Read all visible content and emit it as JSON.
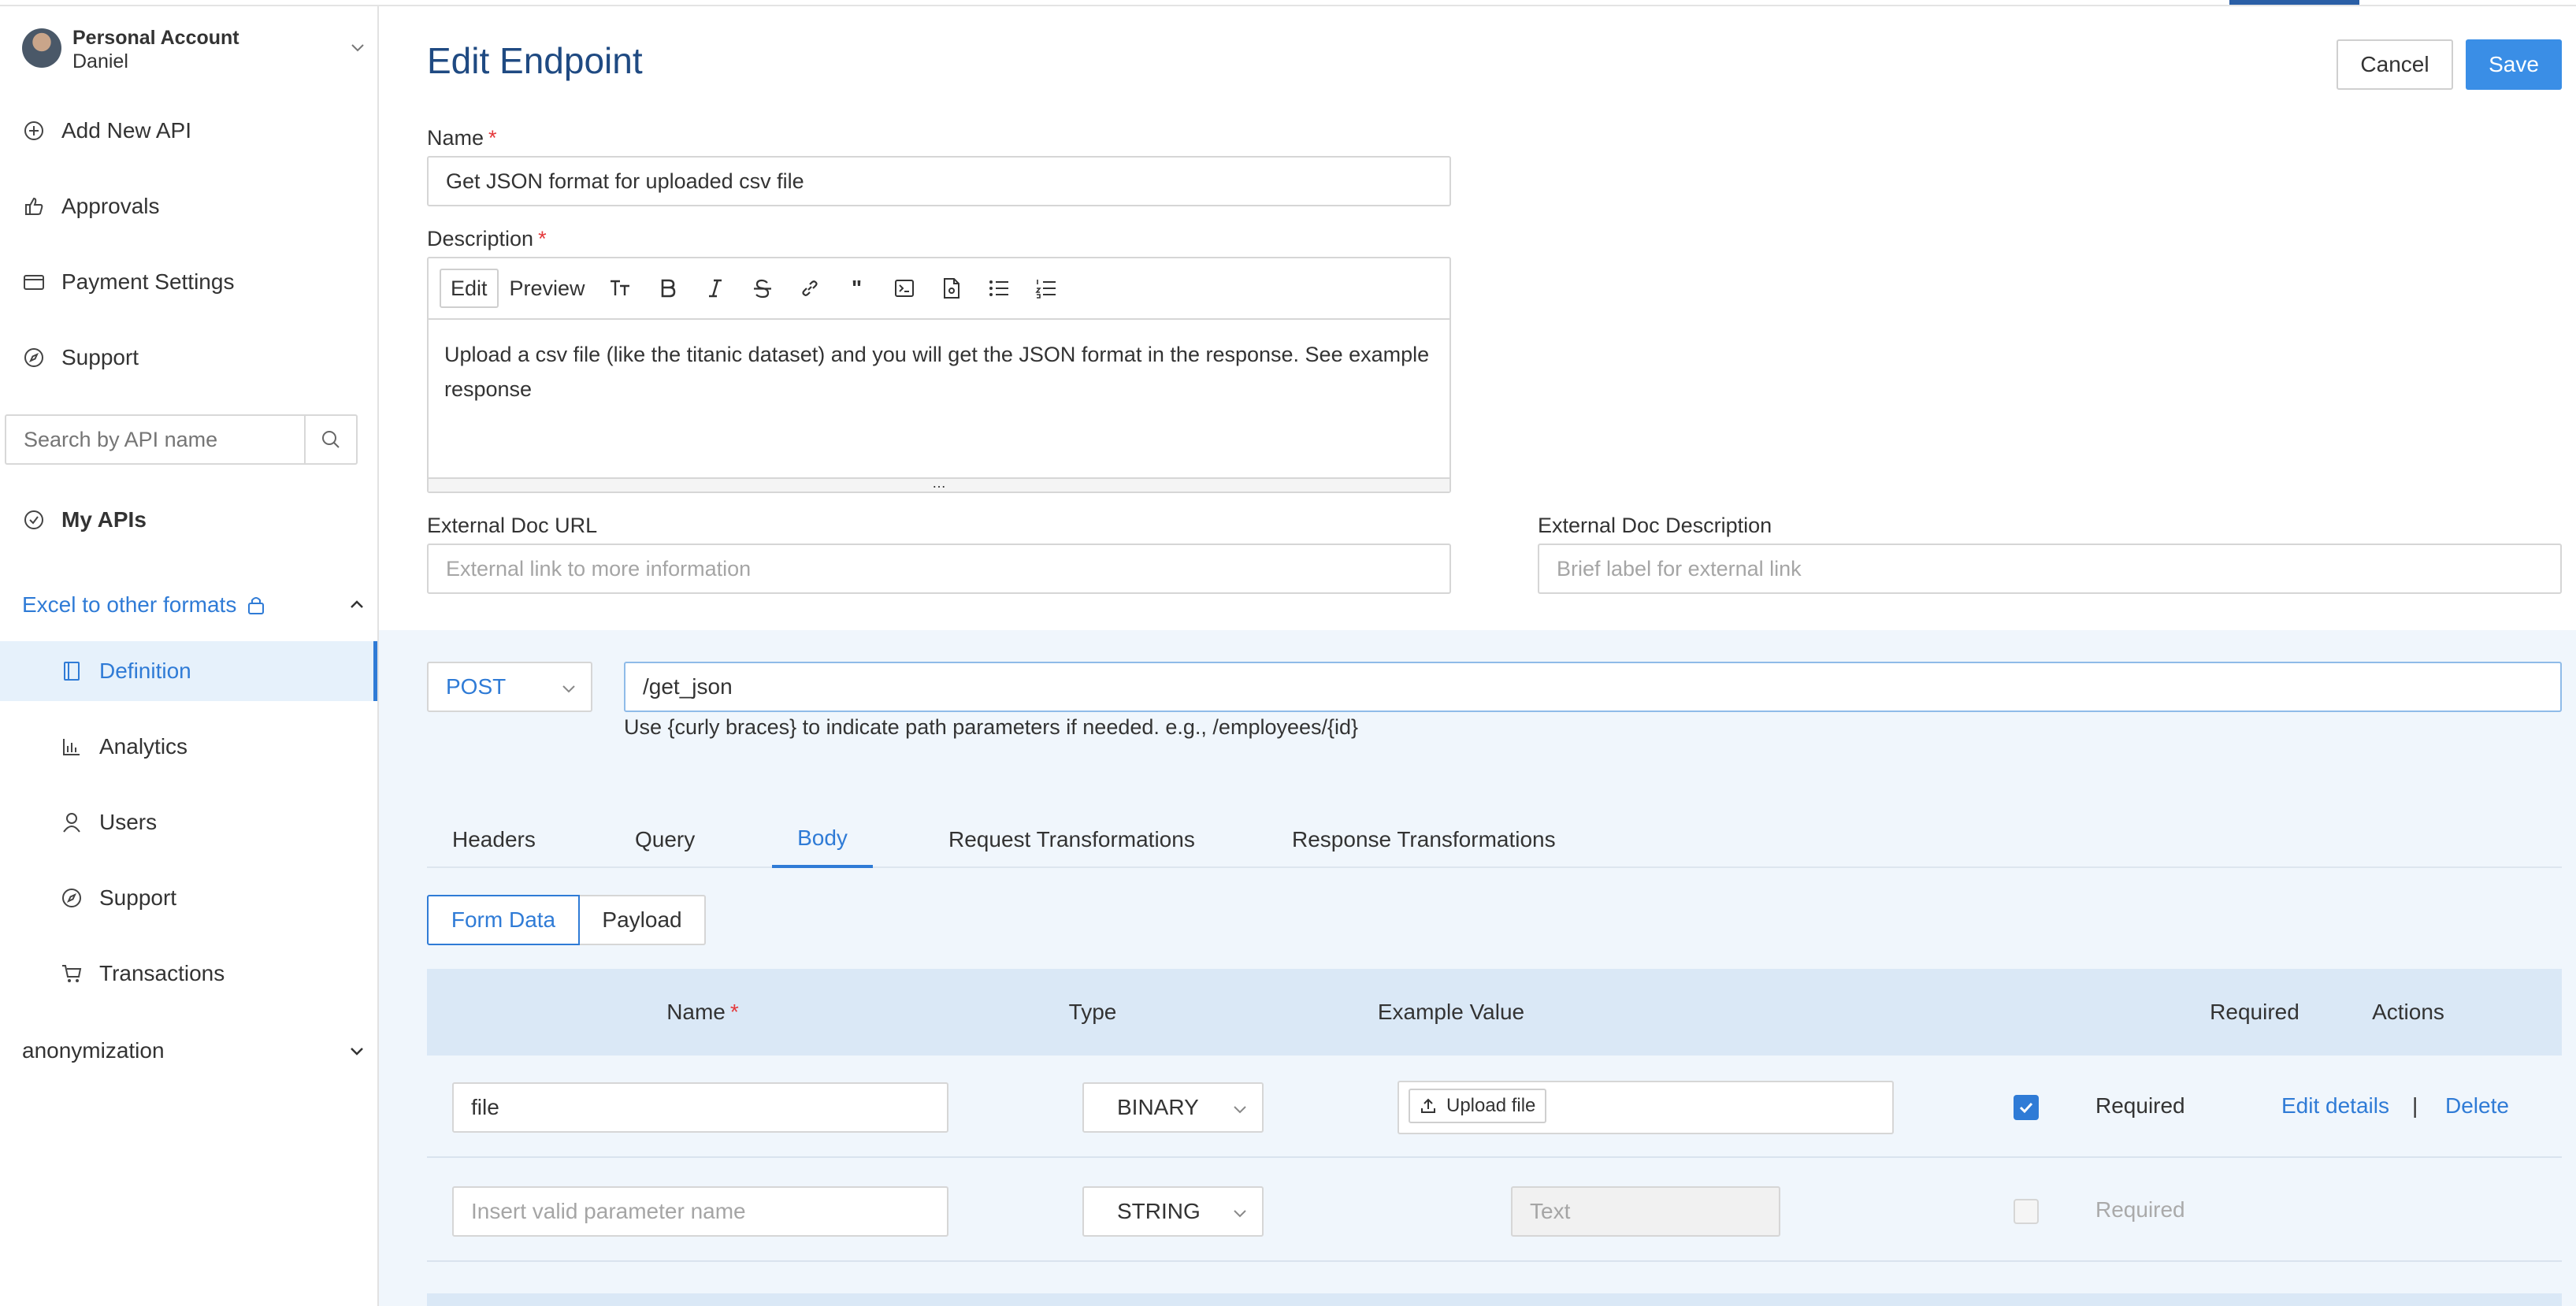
{
  "account": {
    "title": "Personal Account",
    "user": "Daniel"
  },
  "sidebar": {
    "nav": [
      {
        "label": "Add New API"
      },
      {
        "label": "Approvals"
      },
      {
        "label": "Payment Settings"
      },
      {
        "label": "Support"
      }
    ],
    "search_placeholder": "Search by API name",
    "my_apis": "My APIs",
    "api_group": "Excel to other formats",
    "sub_items": [
      {
        "label": "Definition"
      },
      {
        "label": "Analytics"
      },
      {
        "label": "Users"
      },
      {
        "label": "Support"
      },
      {
        "label": "Transactions"
      }
    ],
    "other_api": "anonymization"
  },
  "header": {
    "title": "Edit Endpoint",
    "cancel": "Cancel",
    "save": "Save"
  },
  "form": {
    "name_label": "Name",
    "name_value": "Get JSON format for uploaded csv file",
    "description_label": "Description",
    "editor": {
      "edit": "Edit",
      "preview": "Preview",
      "text": "Upload  a csv file (like the titanic dataset) and you will get the JSON format in the response. See example response"
    },
    "ext_doc_url_label": "External Doc URL",
    "ext_doc_url_placeholder": "External link to more information",
    "ext_doc_desc_label": "External Doc Description",
    "ext_doc_desc_placeholder": "Brief label for external link",
    "required_mark": "*"
  },
  "endpoint": {
    "method": "POST",
    "path": "/get_json",
    "hint": "Use {curly braces} to indicate path parameters if needed. e.g., /employees/{id}"
  },
  "tabs": [
    {
      "label": "Headers"
    },
    {
      "label": "Query"
    },
    {
      "label": "Body"
    },
    {
      "label": "Request Transformations"
    },
    {
      "label": "Response Transformations"
    }
  ],
  "body_mode": {
    "form_data": "Form Data",
    "payload": "Payload"
  },
  "table": {
    "headers": {
      "name": "Name",
      "type": "Type",
      "example": "Example Value",
      "required": "Required",
      "actions": "Actions"
    },
    "rows": [
      {
        "name": "file",
        "type": "BINARY",
        "upload": "Upload file",
        "required_label": "Required",
        "required": true,
        "edit": "Edit details",
        "separator": "|",
        "delete": "Delete"
      },
      {
        "name_placeholder": "Insert valid parameter name",
        "type": "STRING",
        "example_placeholder": "Text",
        "required_label": "Required",
        "required": false
      }
    ]
  },
  "colors": {
    "accent": "#2f7bd6",
    "save_button": "#3a8ee6",
    "title": "#1f4a82",
    "section_bg": "#f0f6fc",
    "table_header_bg": "#dae8f6"
  }
}
